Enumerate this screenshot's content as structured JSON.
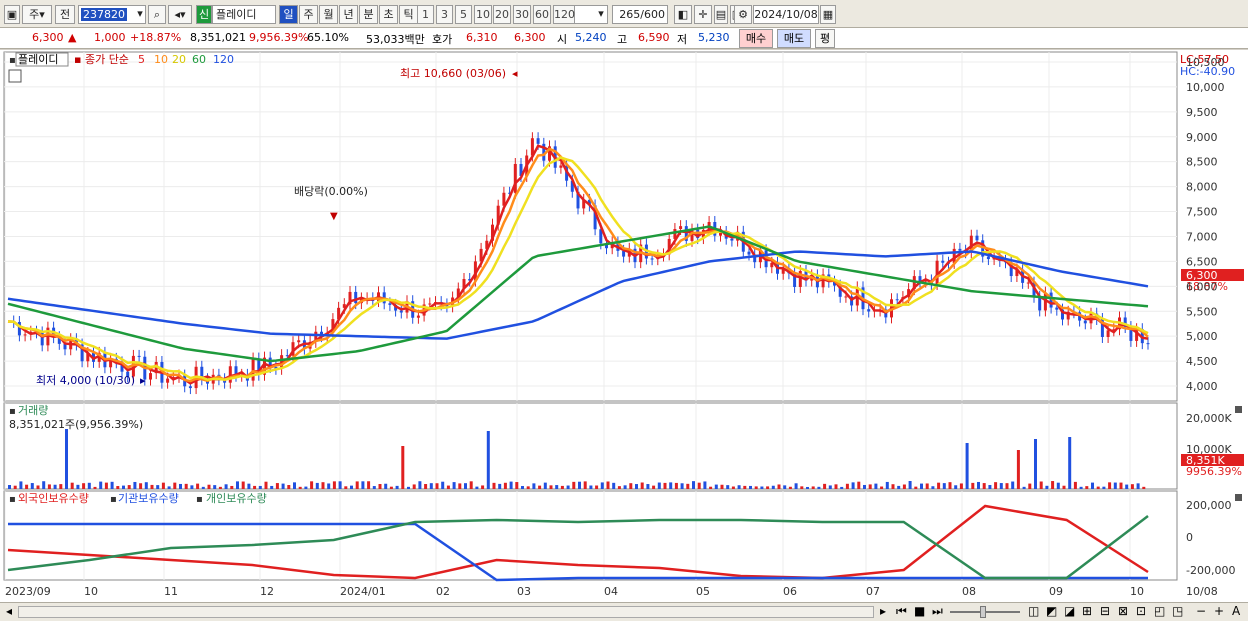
{
  "toolbar": {
    "market": "주",
    "prev": "전",
    "code": "237820",
    "name": "플레이디",
    "name_badge": "신",
    "period_tabs": [
      "일",
      "주",
      "월",
      "년",
      "분",
      "초",
      "틱"
    ],
    "intervals": [
      "1",
      "3",
      "5",
      "10",
      "20",
      "30",
      "60",
      "120"
    ],
    "count": "265",
    "count_total": "/600",
    "date": "2024/10/08"
  },
  "quote": {
    "price": "6,300",
    "arrow": "▲",
    "change": "1,000",
    "change_pct": "+18.87%",
    "volume": "8,351,021",
    "volume_pct": "9,956.39%",
    "turnover": "65.10%",
    "amount": "53,033백만",
    "hoga_label": "호가",
    "bid": "6,310",
    "ask": "6,300",
    "open_label": "시",
    "open": "5,240",
    "high_label": "고",
    "high": "6,590",
    "low_label": "저",
    "low": "5,230",
    "buy_label": "매수",
    "sell_label": "매도",
    "avg_label": "평"
  },
  "price_panel": {
    "stock_name": "플레이디",
    "legend_prefix": "종가 단순",
    "ma_labels": [
      "5",
      "10",
      "20",
      "60",
      "120"
    ],
    "ma_colors": [
      "#e02020",
      "#ff8c1a",
      "#f0e020",
      "#1e9a3c",
      "#2050e0"
    ],
    "lc_label": "LC:57.50",
    "hc_label": "HC:-40.90",
    "current_price_tag": "6,300",
    "current_pct_tag": "18.87%",
    "annotation_high": "최고 10,660 (03/06)",
    "annotation_low": "최저 4,000 (10/30)",
    "annotation_dividend": "배당락(0.00%)",
    "y_ticks": [
      "10,500",
      "10,000",
      "9,500",
      "9,000",
      "8,500",
      "8,000",
      "7,500",
      "7,000",
      "6,500",
      "6,000",
      "5,500",
      "5,000",
      "4,500",
      "4,000"
    ]
  },
  "volume_panel": {
    "title": "거래량",
    "value": "8,351,021주(9,956.39%)",
    "y_ticks": [
      "20,000K",
      "10,000K"
    ],
    "current_tag": "8,351K",
    "current_pct_tag": "9956.39%"
  },
  "holding_panel": {
    "legends": [
      "외국인보유수량",
      "기관보유수량",
      "개인보유수량"
    ],
    "colors": [
      "#e02020",
      "#2050e0",
      "#2e8b57"
    ],
    "y_ticks": [
      "200,000",
      "0",
      "-200,000"
    ]
  },
  "x_axis": [
    "2023/09",
    "10",
    "11",
    "12",
    "2024/01",
    "02",
    "03",
    "04",
    "05",
    "06",
    "07",
    "08",
    "09",
    "10",
    "10/08"
  ],
  "chart_data": {
    "type": "line",
    "title": "플레이디 일봉",
    "x": [
      "2023/09",
      "10",
      "11",
      "12",
      "2024/01",
      "02",
      "03",
      "04",
      "05",
      "06",
      "07",
      "08",
      "09",
      "10"
    ],
    "series": [
      {
        "name": "종가",
        "values": [
          5300,
          4600,
          4100,
          4400,
          5800,
          5400,
          9000,
          6500,
          7300,
          6200,
          5600,
          6800,
          5400,
          5000
        ]
      },
      {
        "name": "120",
        "values": [
          5750,
          5500,
          5250,
          5050,
          5000,
          4950,
          5300,
          6100,
          6500,
          6700,
          6600,
          6700,
          6300,
          6000
        ]
      },
      {
        "name": "60",
        "values": [
          5650,
          5200,
          4750,
          4500,
          4700,
          5100,
          6600,
          6900,
          7200,
          6500,
          6200,
          5900,
          5750,
          5600
        ]
      }
    ],
    "ylim": [
      3700,
      10700
    ]
  }
}
